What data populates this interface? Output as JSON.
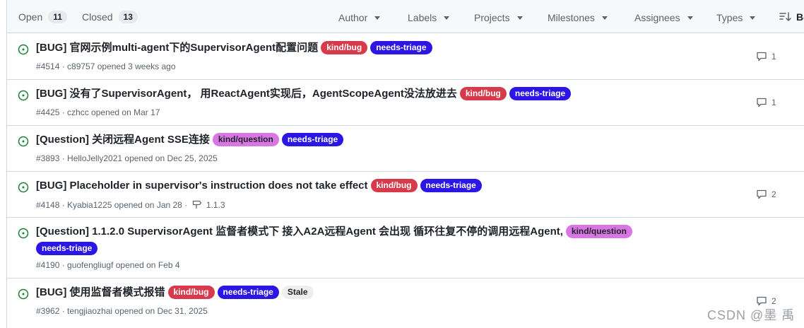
{
  "header": {
    "open_label": "Open",
    "open_count": "11",
    "closed_label": "Closed",
    "closed_count": "13",
    "filters": [
      "Author",
      "Labels",
      "Projects",
      "Milestones",
      "Assignees",
      "Types"
    ],
    "sort_label": "Be"
  },
  "issues": [
    {
      "title": "[BUG] 官网示例multi-agent下的SupervisorAgent配置问题",
      "labels": [
        {
          "name": "kind/bug",
          "color": "#d73a4a"
        },
        {
          "name": "needs-triage",
          "color": "#2b16e6"
        }
      ],
      "meta": "#4514 · c89757 opened 3 weeks ago",
      "milestone": "",
      "comments": "1"
    },
    {
      "title": "[BUG] 没有了SupervisorAgent， 用ReactAgent实现后，AgentScopeAgent没法放进去",
      "labels": [
        {
          "name": "kind/bug",
          "color": "#d73a4a"
        },
        {
          "name": "needs-triage",
          "color": "#2b16e6"
        }
      ],
      "meta": "#4425 · czhcc opened on Mar 17",
      "milestone": "",
      "comments": "1"
    },
    {
      "title": "[Question] 关闭远程Agent SSE连接",
      "labels": [
        {
          "name": "kind/question",
          "color": "#d876e3"
        },
        {
          "name": "needs-triage",
          "color": "#2b16e6"
        }
      ],
      "meta": "#3893 · HelloJelly2021 opened on Dec 25, 2025",
      "milestone": "",
      "comments": ""
    },
    {
      "title": "[BUG] Placeholder in supervisor's instruction does not take effect",
      "labels": [
        {
          "name": "kind/bug",
          "color": "#d73a4a"
        },
        {
          "name": "needs-triage",
          "color": "#2b16e6"
        }
      ],
      "meta": "#4148 · Kyabia1225 opened on Jan 28 ·",
      "milestone": "1.1.3",
      "comments": "2"
    },
    {
      "title": "[Question] 1.1.2.0 SupervisorAgent 监督者模式下 接入A2A远程Agent 会出现 循环往复不停的调用远程Agent,",
      "labels": [
        {
          "name": "kind/question",
          "color": "#d876e3"
        },
        {
          "name": "needs-triage",
          "color": "#2b16e6"
        }
      ],
      "meta": "#4190 · guofengliugf opened on Feb 4",
      "milestone": "",
      "comments": ""
    },
    {
      "title": "[BUG] 使用监督者模式报错",
      "labels": [
        {
          "name": "kind/bug",
          "color": "#d73a4a"
        },
        {
          "name": "needs-triage",
          "color": "#2b16e6"
        },
        {
          "name": "Stale",
          "color": "#eeeeee",
          "text_color": "#1f2328"
        }
      ],
      "meta": "#3962 · tengjiaozhai opened on Dec 31, 2025",
      "milestone": "",
      "comments": "2"
    }
  ],
  "watermark": "CSDN @墨 禹",
  "colors": {
    "open_green": "#1a7f37",
    "header_bg": "#f6f8fa",
    "border": "#d1d9e0"
  }
}
